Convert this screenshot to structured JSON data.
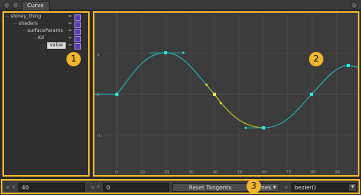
{
  "window": {
    "tab_title": "Curve"
  },
  "tree": {
    "items": [
      {
        "label": "shiney_thing",
        "eq": "=",
        "indent": 0
      },
      {
        "label": "shaders",
        "eq": "=",
        "indent": 1
      },
      {
        "label": "surfaceParams",
        "eq": "=",
        "indent": 2
      },
      {
        "label": "Kd",
        "eq": "=",
        "indent": 3
      },
      {
        "label": "value",
        "eq": "=",
        "indent": 4,
        "selected": true
      }
    ]
  },
  "badges": {
    "one": "1",
    "two": "2",
    "three": "3"
  },
  "graph": {
    "x_ticks": [
      "0",
      "10",
      "20",
      "30",
      "40",
      "50",
      "60",
      "70",
      "80",
      "90"
    ],
    "y_ticks": [
      "1",
      "0",
      "-1"
    ],
    "colors": {
      "curve": "#2aa7a7",
      "selected": "#b7b51f",
      "key": "#2ee0e0",
      "grid": "#4a4a4a",
      "axis": "#5d5d5d"
    }
  },
  "bottom": {
    "x_label": "X",
    "x_value": "40",
    "y_label": "Y",
    "y_value": "0",
    "reset_tangents_label": "Reset Tangents",
    "mode_label": "Times",
    "interp_label": "bezier()"
  }
}
